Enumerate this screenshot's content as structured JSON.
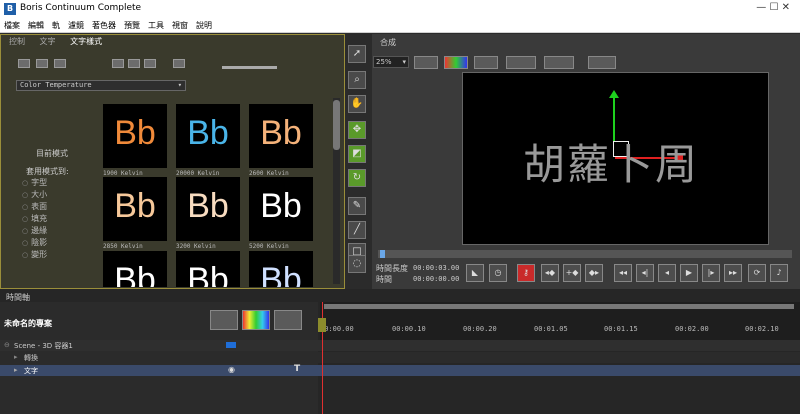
{
  "window": {
    "title": "Boris Continuum Complete",
    "logo": "B",
    "controls": "—  ☐  ✕"
  },
  "menu": [
    "檔案",
    "編輯",
    "軌",
    "濾鏡",
    "著色器",
    "預覽",
    "工具",
    "視窗",
    "說明"
  ],
  "left_panel": {
    "tabs": [
      "控制",
      "文字",
      "文字樣式"
    ],
    "preset_dropdown": "Color Temperature",
    "current_mode_label": "目前模式",
    "apply_to_label": "套用模式到:",
    "apply_items": [
      "字型",
      "大小",
      "表面",
      "填充",
      "邊緣",
      "陰影",
      "變形"
    ],
    "thumbnails": [
      {
        "label": "Bb",
        "caption": "1900 Kelvin",
        "color": "#f08a3a"
      },
      {
        "label": "Bb",
        "caption": "20000 Kelvin",
        "color": "#4ab4e8"
      },
      {
        "label": "Bb",
        "caption": "2600 Kelvin",
        "color": "#f4b27a"
      },
      {
        "label": "Bb",
        "caption": "2850 Kelvin",
        "color": "#f6c89a"
      },
      {
        "label": "Bb",
        "caption": "3200 Kelvin",
        "color": "#f8dcc0"
      },
      {
        "label": "Bb",
        "caption": "5200 Kelvin",
        "color": "#ffffff"
      },
      {
        "label": "Bb",
        "caption": "",
        "color": "#ffffff"
      },
      {
        "label": "Bb",
        "caption": "",
        "color": "#ffffff"
      },
      {
        "label": "Bb",
        "caption": "",
        "color": "#cfe0ff"
      }
    ]
  },
  "composite": {
    "tab": "合成",
    "zoom": "25%",
    "viewer_text": "胡蘿卜周",
    "length_label": "時間長度",
    "length_value": "00:00:03.00",
    "time_label": "時間",
    "time_value": "00:00:00.00"
  },
  "timeline": {
    "tab": "時間軸",
    "project_name": "未命名的專案",
    "tracks": [
      {
        "label": "Scene - 3D 容器1",
        "indent": 0
      },
      {
        "label": "轉換",
        "indent": 1
      },
      {
        "label": "文字",
        "indent": 1
      }
    ],
    "ruler_ticks": [
      "00:00.00",
      "00:00.10",
      "00:00.20",
      "00:01.05",
      "00:01.15",
      "00:02.00",
      "00:02.10"
    ]
  },
  "colors": {
    "accent_red": "#c92a2a",
    "panel_border": "#9a8e3a",
    "tool_green": "#5a9a2a"
  }
}
